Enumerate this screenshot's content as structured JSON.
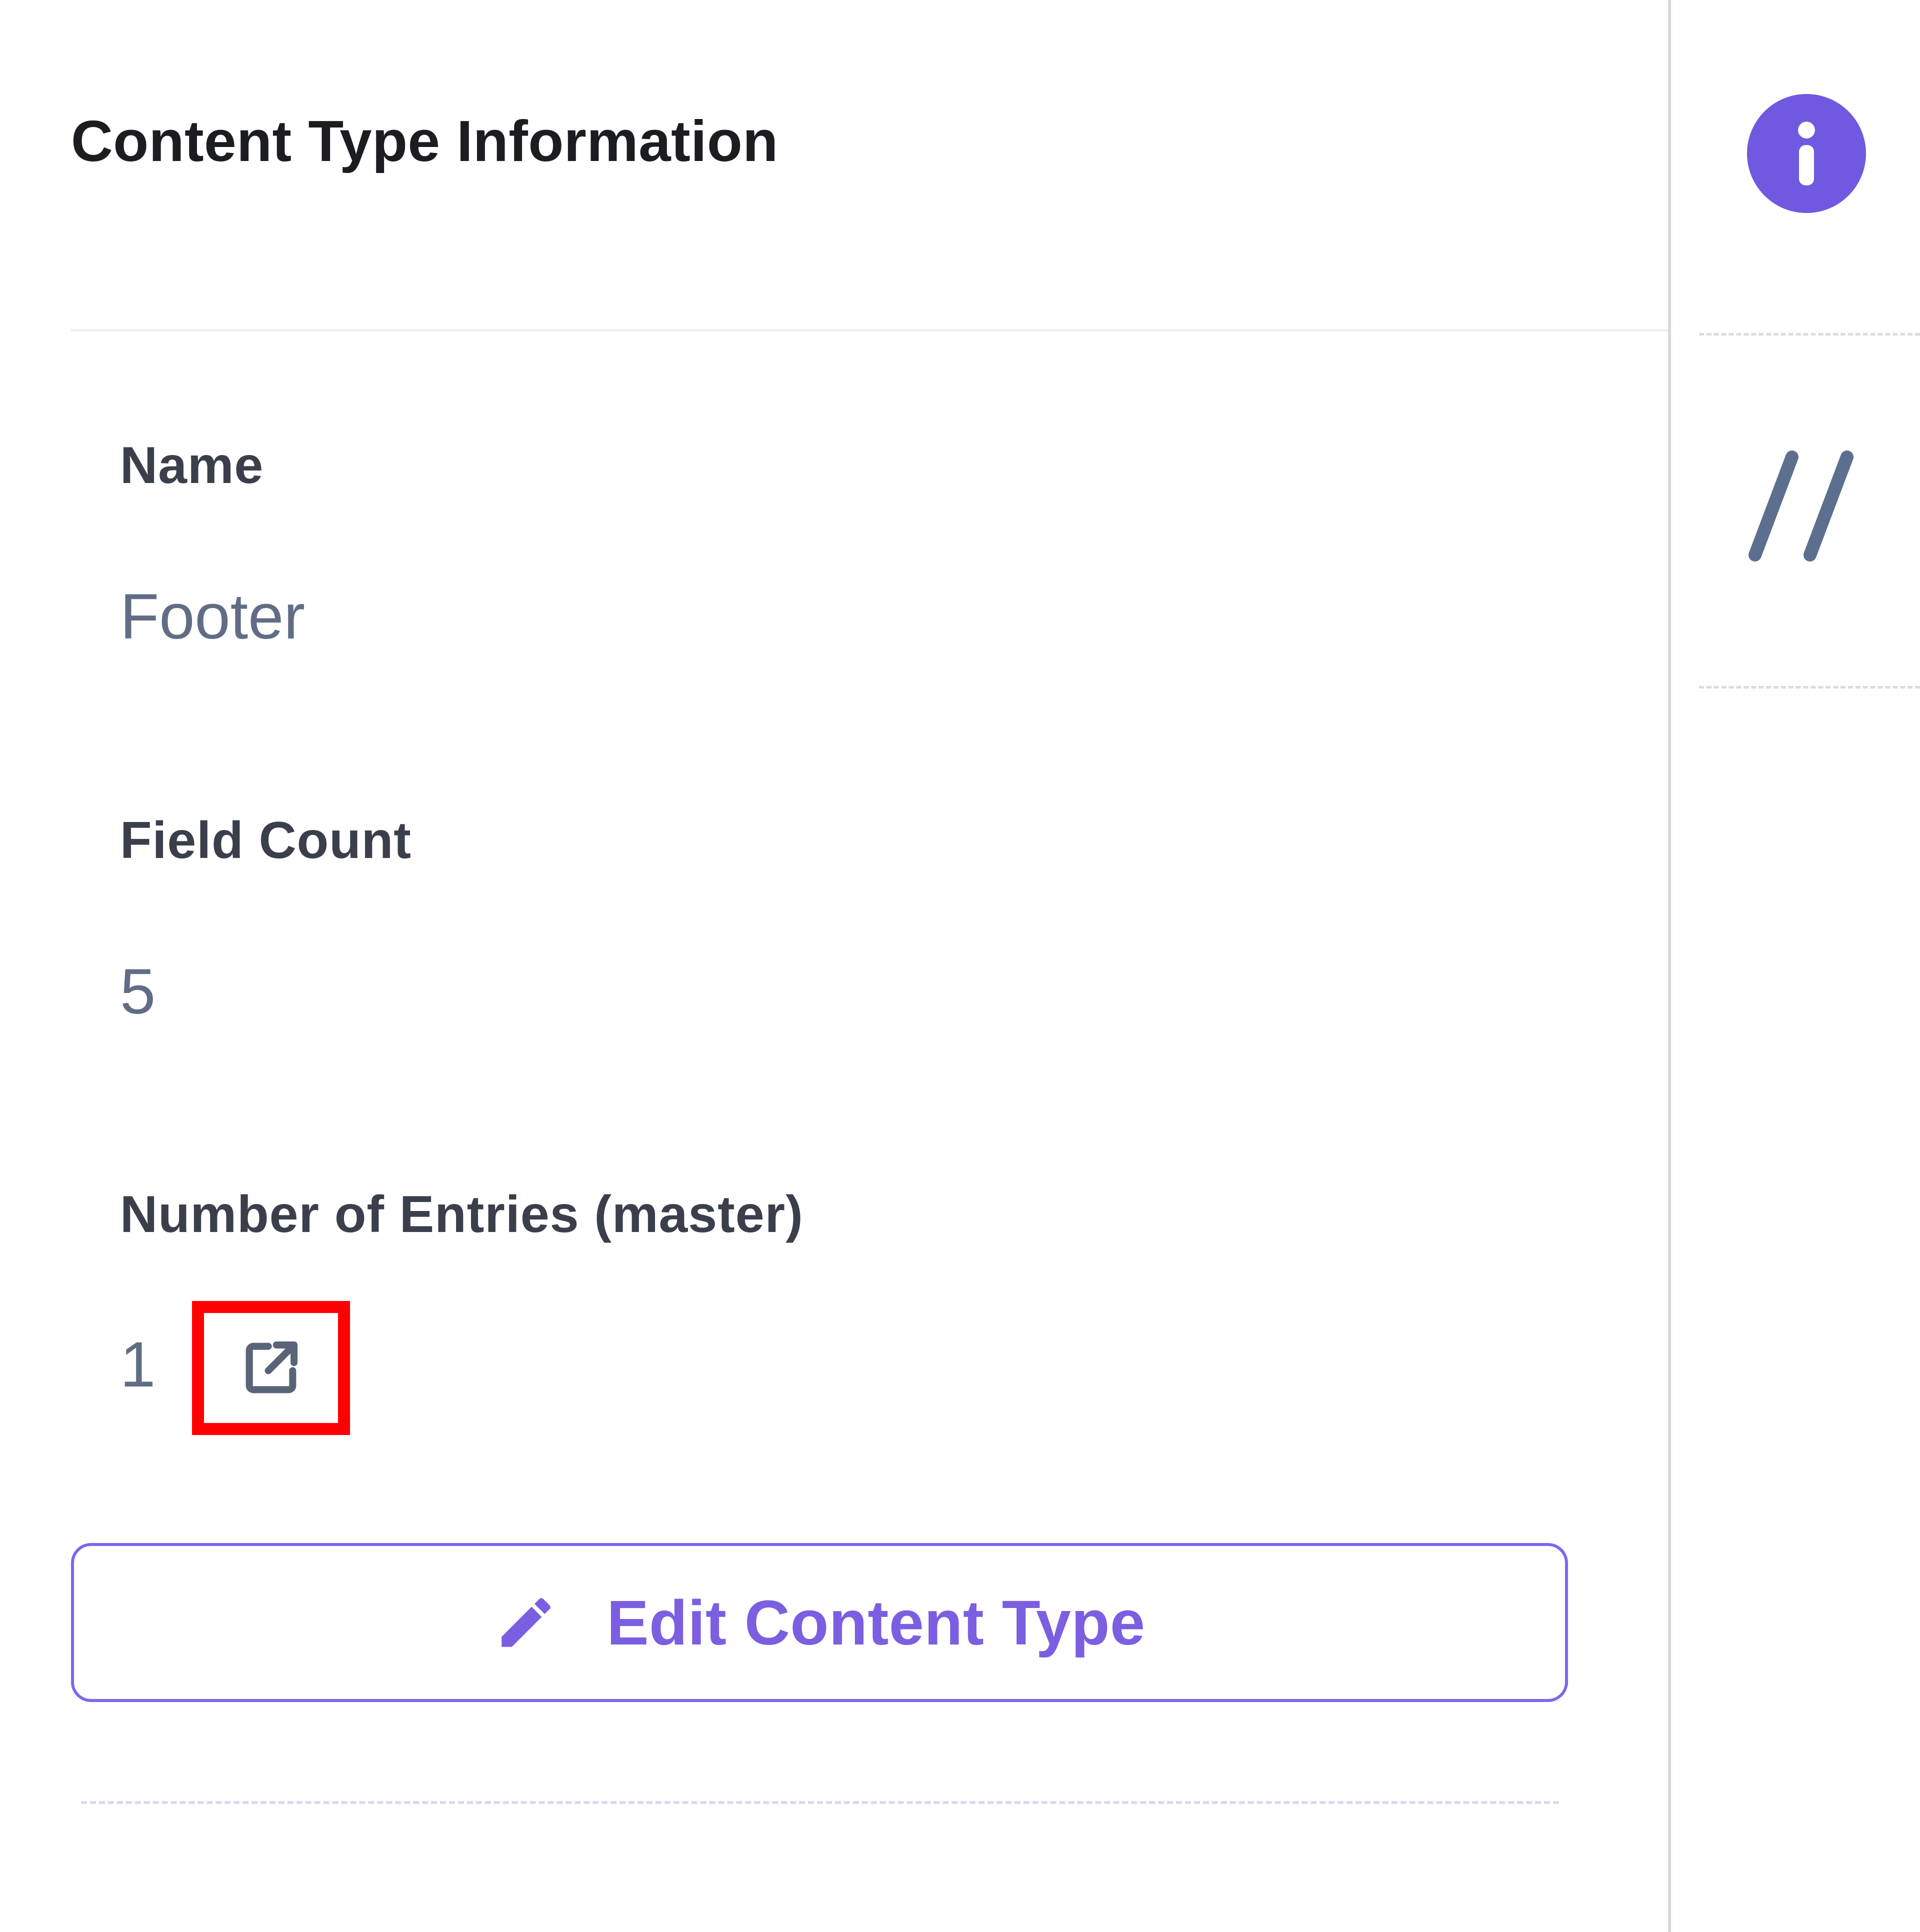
{
  "panel": {
    "title": "Content Type Information",
    "fields": [
      {
        "label": "Name",
        "value": "Footer"
      },
      {
        "label": "Field Count",
        "value": "5"
      },
      {
        "label": "Number of Entries (master)",
        "value": "1"
      }
    ],
    "open_entries_icon": "external-link-icon",
    "edit_button": {
      "label": "Edit Content Type",
      "icon": "pencil-icon"
    }
  },
  "right_rail": {
    "items": [
      {
        "icon": "info-icon"
      },
      {
        "icon": "slash-slash-icon"
      }
    ]
  },
  "colors": {
    "accent": "#7b68ee",
    "info_circle": "#7059e0",
    "highlight_box": "#ff0000",
    "value_text": "#616d86",
    "label_text": "#3a3f4b"
  }
}
